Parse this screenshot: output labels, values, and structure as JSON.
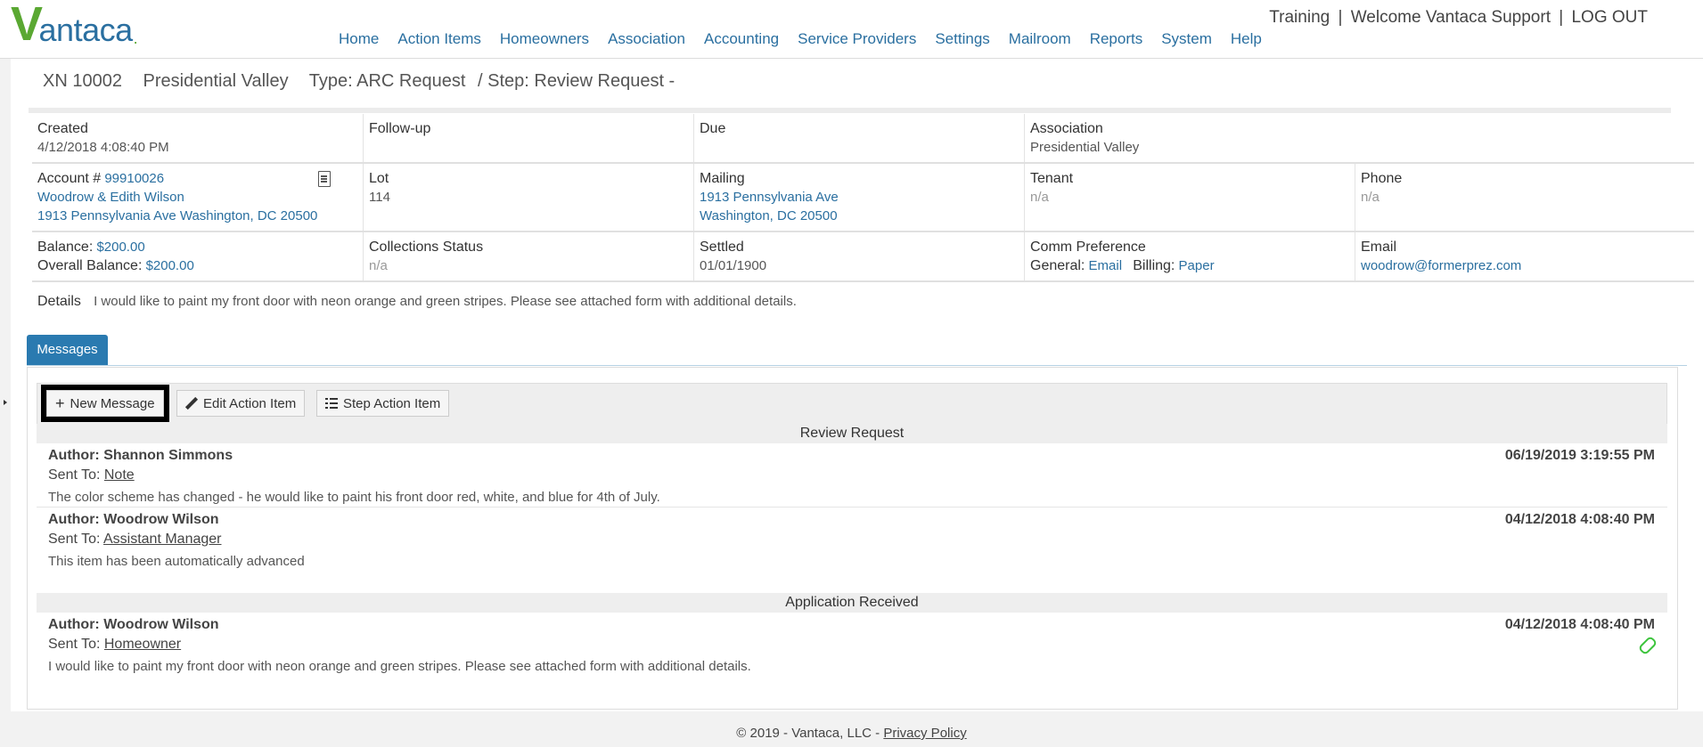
{
  "header": {
    "logo_v": "V",
    "logo_rest": "antaca",
    "logo_dot": ".",
    "topright": {
      "training": "Training",
      "sep1": "|",
      "welcome": "Welcome Vantaca Support",
      "sep2": "|",
      "logout": "LOG OUT"
    },
    "nav": [
      "Home",
      "Action Items",
      "Homeowners",
      "Association",
      "Accounting",
      "Service Providers",
      "Settings",
      "Mailroom",
      "Reports",
      "System",
      "Help"
    ]
  },
  "title": {
    "id": "XN 10002",
    "association": "Presidential Valley",
    "type": "Type: ARC Request",
    "step": "/ Step: Review Request -"
  },
  "info": {
    "created_label": "Created",
    "created_value": "4/12/2018 4:08:40 PM",
    "followup_label": "Follow-up",
    "due_label": "Due",
    "association_label": "Association",
    "association_value": "Presidential Valley",
    "account_label": "Account #",
    "account_number": "99910026",
    "account_name": "Woodrow & Edith Wilson",
    "account_address": "1913 Pennsylvania Ave Washington, DC 20500",
    "lot_label": "Lot",
    "lot_value": "114",
    "mailing_label": "Mailing",
    "mailing_line1": "1913 Pennsylvania Ave",
    "mailing_line2": "Washington, DC 20500",
    "tenant_label": "Tenant",
    "tenant_value": "n/a",
    "phone_label": "Phone",
    "phone_value": "n/a",
    "balance_label": "Balance:",
    "balance_value": "$200.00",
    "overall_label": "Overall Balance:",
    "overall_value": "$200.00",
    "collections_label": "Collections Status",
    "collections_value": "n/a",
    "settled_label": "Settled",
    "settled_value": "01/01/1900",
    "comm_label": "Comm Preference",
    "comm_general_label": "General:",
    "comm_general_value": "Email",
    "comm_billing_label": "Billing:",
    "comm_billing_value": "Paper",
    "email_label": "Email",
    "email_value": "woodrow@formerprez.com"
  },
  "details": {
    "label": "Details",
    "text": "I would like to paint my front door with neon orange and green stripes. Please see attached form with additional details."
  },
  "tabs": [
    {
      "label": "Messages"
    }
  ],
  "toolbar": {
    "new_message": "New Message",
    "edit_action": "Edit Action Item",
    "step_action": "Step Action Item"
  },
  "groups": [
    {
      "title": "Review Request"
    },
    {
      "title": "Application Received"
    }
  ],
  "messages": [
    {
      "author": "Author: Shannon Simmons",
      "date": "06/19/2019 3:19:55 PM",
      "sent_label": "Sent To:",
      "sent_to": "Note",
      "body": "The color scheme has changed - he would like to paint his front door red, white, and blue for 4th of July."
    },
    {
      "author": "Author: Woodrow Wilson",
      "date": "04/12/2018 4:08:40 PM",
      "sent_label": "Sent To:",
      "sent_to": "Assistant Manager",
      "body": "This item has been automatically advanced"
    },
    {
      "author": "Author: Woodrow Wilson",
      "date": "04/12/2018 4:08:40 PM",
      "sent_label": "Sent To:",
      "sent_to": "Homeowner",
      "body": "I would like to paint my front door with neon orange and green stripes. Please see attached form with additional details."
    }
  ],
  "footer": {
    "copyright": "© 2019 - Vantaca, LLC -",
    "privacy": "Privacy Policy"
  },
  "colors": {
    "brand_blue": "#2a6fa0",
    "brand_green": "#5aa832",
    "tab_blue": "#2a7ab0",
    "attachment_green": "#3cc43c"
  }
}
